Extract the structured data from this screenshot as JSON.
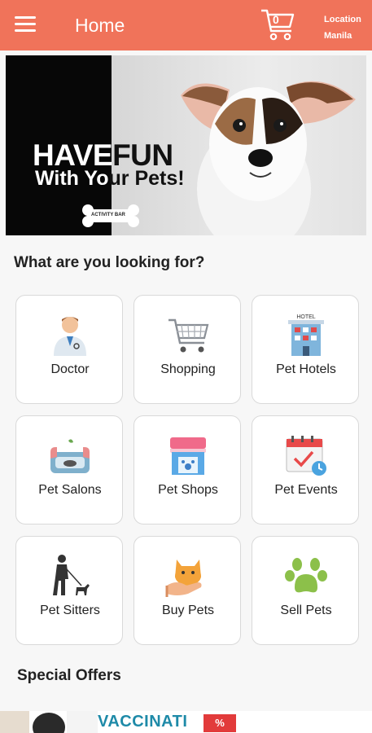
{
  "appbar": {
    "title": "Home",
    "cart_count": "0",
    "location_label": "Location",
    "location_value": "Manila"
  },
  "banner": {
    "line1_dark": "HAVE",
    "line1_light": "FUN",
    "line2_dark": "With Yo",
    "line2_light": "ur Pets!",
    "badge": "ACTIVITY BAR"
  },
  "categories_title": "What are you looking for?",
  "categories": [
    {
      "label": "Doctor",
      "icon": "doctor-icon"
    },
    {
      "label": "Shopping",
      "icon": "shopping-cart-icon"
    },
    {
      "label": "Pet Hotels",
      "icon": "hotel-icon",
      "sign": "HOTEL"
    },
    {
      "label": "Pet Salons",
      "icon": "pet-salon-icon"
    },
    {
      "label": "Pet Shops",
      "icon": "pet-shop-icon"
    },
    {
      "label": "Pet Events",
      "icon": "calendar-icon"
    },
    {
      "label": "Pet Sitters",
      "icon": "dog-walker-icon"
    },
    {
      "label": "Buy Pets",
      "icon": "cat-in-hand-icon"
    },
    {
      "label": "Sell Pets",
      "icon": "paw-icon"
    }
  ],
  "offers_title": "Special Offers",
  "offer_banner": {
    "text": "VACCINATI",
    "badge": "%"
  },
  "colors": {
    "brand": "#f0735a",
    "card_border": "#d9d9d9",
    "offer_text": "#1e8aa8"
  }
}
